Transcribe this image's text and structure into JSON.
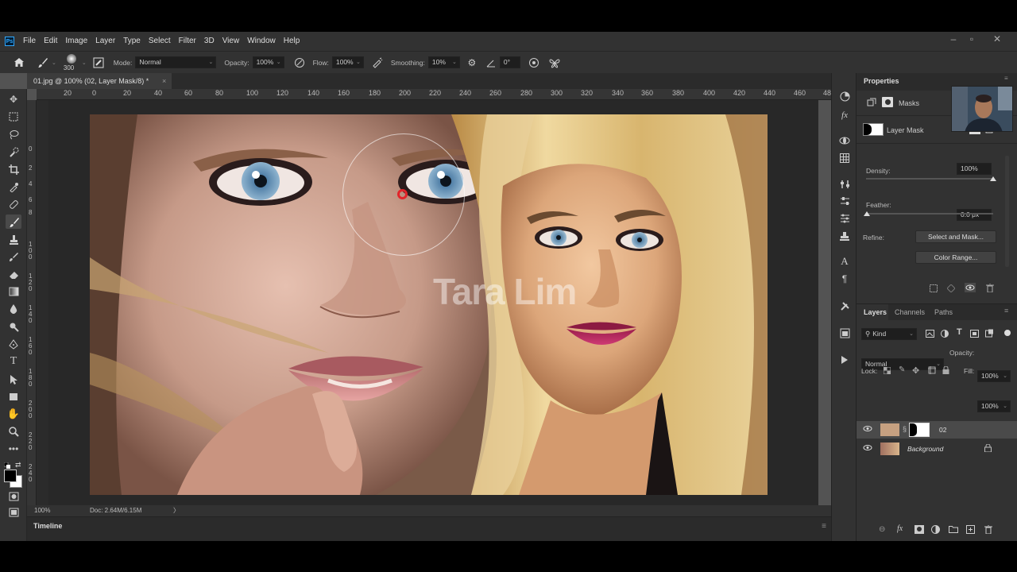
{
  "menubar": {
    "logo": "Ps",
    "items": [
      "File",
      "Edit",
      "Image",
      "Layer",
      "Type",
      "Select",
      "Filter",
      "3D",
      "View",
      "Window",
      "Help"
    ]
  },
  "options": {
    "brush_size": "300",
    "mode_label": "Mode:",
    "mode_value": "Normal",
    "opacity_label": "Opacity:",
    "opacity_value": "100%",
    "flow_label": "Flow:",
    "flow_value": "100%",
    "smoothing_label": "Smoothing:",
    "smoothing_value": "10%",
    "angle_value": "0°"
  },
  "document": {
    "tab_title": "01.jpg @ 100% (02, Layer Mask/8) *",
    "close": "×",
    "watermark": "Tara Lim",
    "zoom": "100%",
    "doc_info": "Doc: 2.64M/6.15M",
    "status_arrow": "〉"
  },
  "rulers": {
    "h": [
      "20",
      "0",
      "20",
      "40",
      "60",
      "80",
      "100",
      "120",
      "140",
      "160",
      "180",
      "200",
      "220",
      "240",
      "260",
      "280",
      "300",
      "320",
      "340",
      "360",
      "380",
      "400",
      "420",
      "440",
      "460",
      "48"
    ],
    "v": [
      [
        "0"
      ],
      [
        "2"
      ],
      [
        "4"
      ],
      [
        "6"
      ],
      [
        "8"
      ],
      [
        "1",
        "0",
        "0"
      ],
      [
        "1",
        "2",
        "0"
      ],
      [
        "1",
        "4",
        "0"
      ],
      [
        "1",
        "6",
        "0"
      ],
      [
        "1",
        "8",
        "0"
      ],
      [
        "2",
        "0",
        "0"
      ],
      [
        "2",
        "2",
        "0"
      ],
      [
        "2",
        "4",
        "0"
      ]
    ]
  },
  "timeline": {
    "label": "Timeline"
  },
  "properties": {
    "tab": "Properties",
    "masks_label": "Masks",
    "layer_mask_label": "Layer Mask",
    "density_label": "Density:",
    "density_value": "100%",
    "feather_label": "Feather:",
    "feather_value": "0.0 px",
    "refine_label": "Refine:",
    "select_mask_button": "Select and Mask...",
    "color_range_button": "Color Range..."
  },
  "layers_panel": {
    "tabs": [
      "Layers",
      "Channels",
      "Paths"
    ],
    "kind_filter": "Kind",
    "blend_mode": "Normal",
    "opacity_label": "Opacity:",
    "opacity_value": "100%",
    "lock_label": "Lock:",
    "fill_label": "Fill:",
    "fill_value": "100%",
    "layers": [
      {
        "name": "02"
      },
      {
        "name": "Background"
      }
    ]
  }
}
